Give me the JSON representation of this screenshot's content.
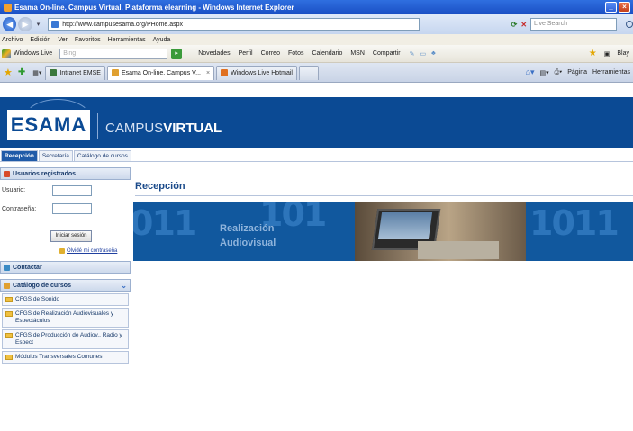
{
  "window": {
    "title": "Esama On-line. Campus Virtual. Plataforma elearning - Windows Internet Explorer"
  },
  "address_bar": {
    "url": "http://www.campusesama.org/PHome.aspx",
    "search_placeholder": "Live Search"
  },
  "menu": [
    "Archivo",
    "Edición",
    "Ver",
    "Favoritos",
    "Herramientas",
    "Ayuda"
  ],
  "live_toolbar": {
    "brand": "Windows Live",
    "search_placeholder": "Bing",
    "links": [
      "Novedades",
      "Perfil",
      "Correo",
      "Fotos",
      "Calendario",
      "MSN",
      "Compartir"
    ],
    "user": "Blay"
  },
  "browser_tabs": [
    {
      "label": "Intranet EMSE",
      "active": false
    },
    {
      "label": "Esama On-line. Campus V...",
      "active": true
    },
    {
      "label": "Windows Live Hotmail",
      "active": false
    }
  ],
  "command_bar": {
    "page": "Página",
    "tools": "Herramientas"
  },
  "site": {
    "logo": "ESAMA",
    "campus_light": "CAMPUS",
    "campus_bold": "VIRTUAL",
    "nav_tabs": [
      "Recepción",
      "Secretaría",
      "Catálogo de cursos"
    ]
  },
  "sidebar": {
    "registered_users": "Usuarios registrados",
    "user_label": "Usuario:",
    "password_label": "Contraseña:",
    "login_button": "Iniciar sesión",
    "forgot_password": "Olvidé mi contraseña",
    "contact": "Contactar",
    "catalog": "Catálogo de cursos",
    "courses": [
      "CFGS de Sonido",
      "CFGS de Realización Audiovisuales y Espectáculos",
      "CFGS de Producción de Audiov., Radio y Espect",
      "Módulos Transversales Comunes"
    ]
  },
  "main": {
    "title": "Recepción",
    "banner_line1": "Realización",
    "banner_line2": "Audiovisual"
  },
  "colors": {
    "header_blue": "#0b4a94",
    "banner_blue": "#11589e",
    "title_blue": "#1a4a8a"
  }
}
